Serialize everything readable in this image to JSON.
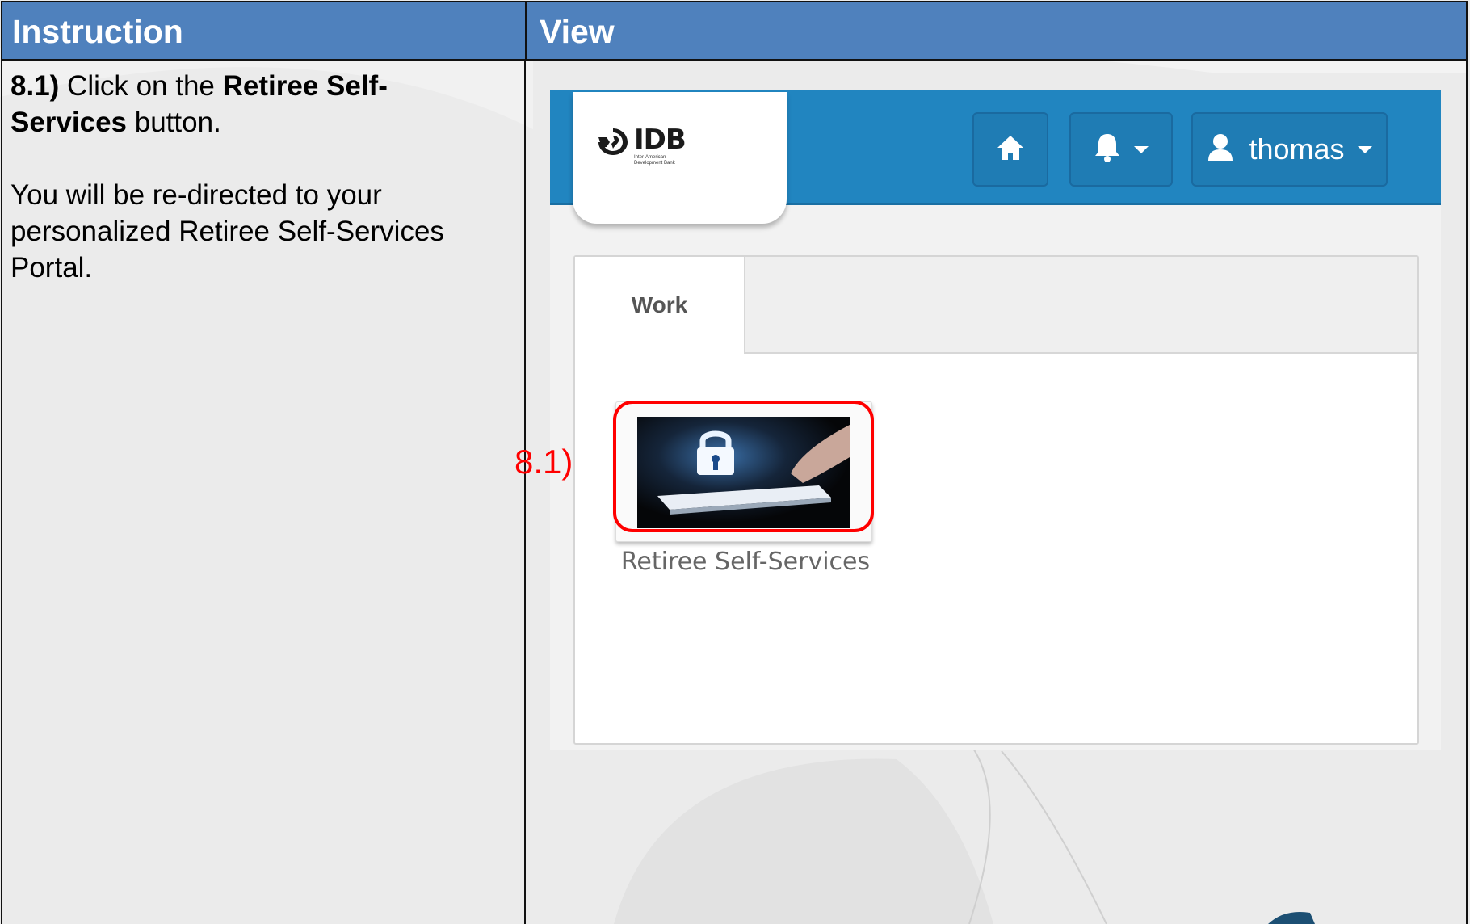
{
  "table": {
    "instruction_header": "Instruction",
    "view_header": "View"
  },
  "instruction": {
    "step_number": "8.1)",
    "click_prefix": " Click on the ",
    "button_name": "Retiree Self-Services",
    "click_suffix": " button.",
    "redirect_text": "You will be re-directed to your personalized Retiree Self-Services Portal."
  },
  "portal": {
    "logo_text": "IDB",
    "logo_subtext": "Inter-American Development Bank",
    "nav": {
      "home_icon": "home-icon",
      "bell_icon": "bell-icon",
      "user_icon": "user-icon",
      "user_name": "thomas"
    },
    "tabs": [
      {
        "label": "Work",
        "active": true
      }
    ],
    "tiles": [
      {
        "label": "Retiree Self-Services",
        "icon": "lock-icon"
      }
    ]
  },
  "annotation": {
    "step_label": "8.1)",
    "highlight_color": "#ff0000"
  },
  "colors": {
    "header_bg": "#4f81bd",
    "nav_bg": "#2185c0"
  }
}
